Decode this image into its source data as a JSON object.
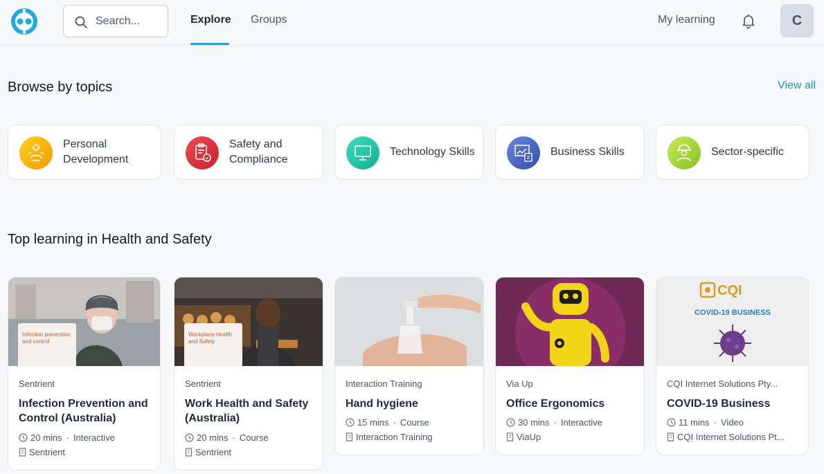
{
  "header": {
    "search_placeholder": "Search...",
    "tabs": [
      {
        "label": "Explore",
        "active": true
      },
      {
        "label": "Groups",
        "active": false
      }
    ],
    "my_learning": "My learning",
    "avatar_initial": "C",
    "accent_color": "#2b9fd6"
  },
  "topics": {
    "title": "Browse by topics",
    "view_all": "View all",
    "items": [
      {
        "label": "Personal Development",
        "icon": "person-growth-icon",
        "color": "#f5b400"
      },
      {
        "label": "Safety and Compliance",
        "icon": "clipboard-check-icon",
        "color": "#e0383e"
      },
      {
        "label": "Technology Skills",
        "icon": "monitor-icon",
        "color": "#23c4a4"
      },
      {
        "label": "Business Skills",
        "icon": "chart-board-icon",
        "color": "#4d6cc7"
      },
      {
        "label": "Sector-specific",
        "icon": "worker-icon",
        "color": "#a8d63a"
      }
    ]
  },
  "health_safety": {
    "title": "Top learning in Health and Safety",
    "courses": [
      {
        "provider": "Sentrient",
        "title": "Infection Prevention and Control (Australia)",
        "duration": "20 mins",
        "type": "Interactive",
        "publisher": "Sentrient",
        "thumb_caption": "Infection prevention and control"
      },
      {
        "provider": "Sentrient",
        "title": "Work Health and Safety (Australia)",
        "duration": "20 mins",
        "type": "Course",
        "publisher": "Sentrient",
        "thumb_caption": "Workplace Health and Safety"
      },
      {
        "provider": "Interaction Training",
        "title": "Hand hygiene",
        "duration": "15 mins",
        "type": "Course",
        "publisher": "Interaction Training"
      },
      {
        "provider": "Via Up",
        "title": "Office Ergonomics",
        "duration": "30 mins",
        "type": "Interactive",
        "publisher": "ViaUp"
      },
      {
        "provider": "CQI Internet Solutions Pty...",
        "title": "COVID-19 Business",
        "duration": "11 mins",
        "type": "Video",
        "publisher": "CQI Internet Solutions Pt...",
        "thumb_brand": "CQI",
        "thumb_text": "COVID-19 BUSINESS"
      }
    ]
  }
}
